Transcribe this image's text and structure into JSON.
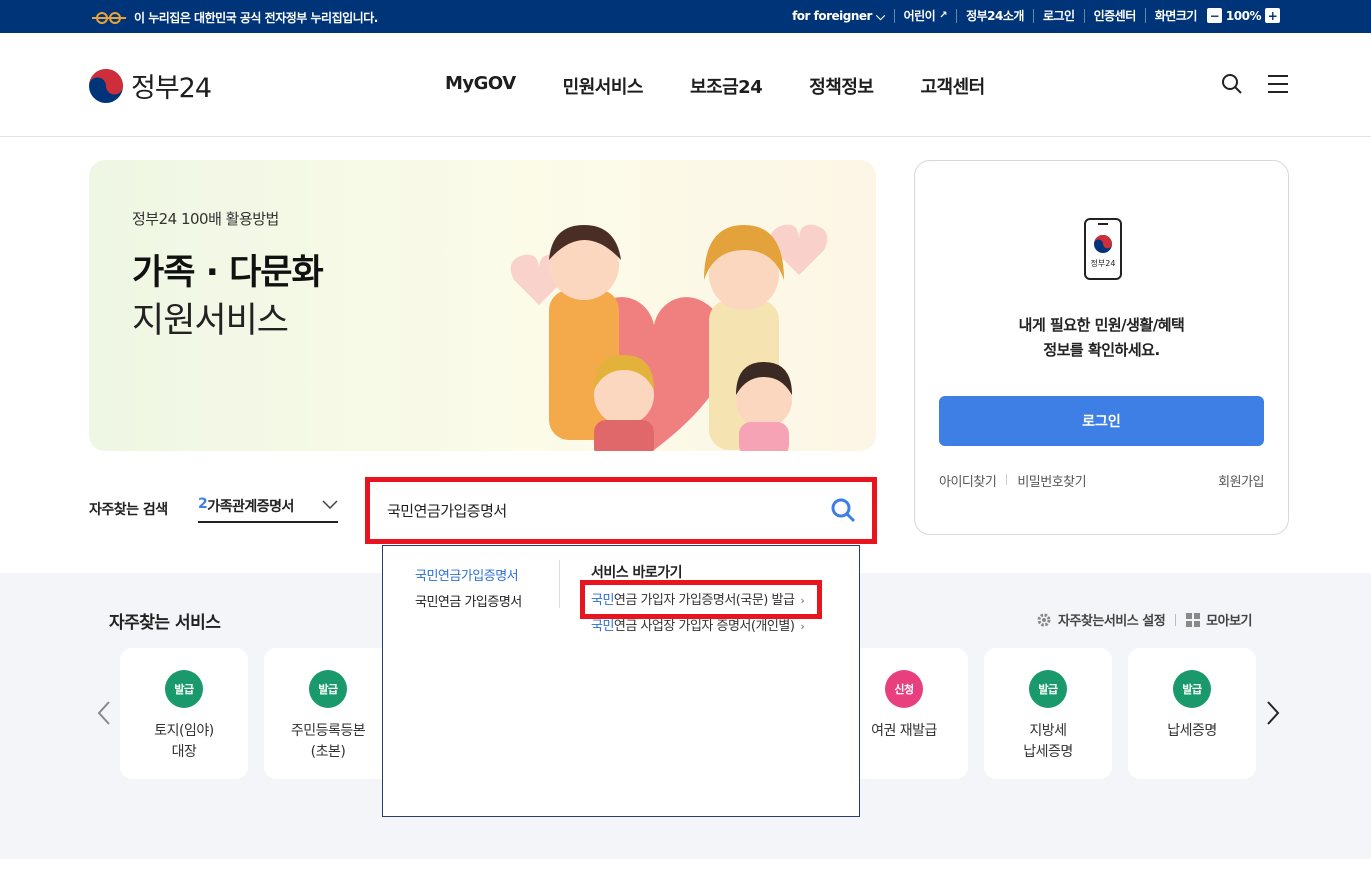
{
  "topbar": {
    "gov_notice": "이 누리집은 대한민국 공식 전자정부 누리집입니다.",
    "links": [
      "for foreigner",
      "어린이",
      "정부24소개",
      "로그인",
      "인증센터"
    ],
    "zoom_label": "화면크기",
    "zoom_value": "100%",
    "zoom_minus": "−",
    "zoom_plus": "+"
  },
  "header": {
    "logo_text": "정부24",
    "nav": [
      "MyGOV",
      "민원서비스",
      "보조금24",
      "정책정보",
      "고객센터"
    ]
  },
  "banner": {
    "subtitle": "정부24 100배 활용방법",
    "title_line1": "가족 · 다문화",
    "title_line2": "지원서비스"
  },
  "login": {
    "phone_label": "정부24",
    "message_line1": "내게 필요한 민원/생활/혜택",
    "message_line2": "정보를 확인하세요.",
    "button": "로그인",
    "find_id": "아이디찾기",
    "find_pw": "비밀번호찾기",
    "signup": "회원가입"
  },
  "search": {
    "fav_label": "자주찾는 검색",
    "fav_num": "2",
    "fav_value": "가족관계증명서",
    "query": "국민연금가입증명서"
  },
  "autocomplete": {
    "suggestions": [
      {
        "hit": "국민연금가입증명서",
        "rest": ""
      },
      {
        "hit": "",
        "rest": "국민연금 가입증명서"
      }
    ],
    "shortcut_header": "서비스 바로가기",
    "shortcuts": [
      {
        "hit": "국민",
        "rest": "연금 가입자 가입증명서(국문) 발급"
      },
      {
        "hit": "국민",
        "rest": "연금 사업장 가입자 증명서(개인별)"
      }
    ],
    "chevron": "›"
  },
  "favorites": {
    "title": "자주찾는 서비스",
    "settings": "자주찾는서비스 설정",
    "view_all": "모아보기",
    "cards": [
      {
        "badge": "발급",
        "badge_color": "#1a9a6c",
        "name": "토지(임야)\n대장"
      },
      {
        "badge": "발급",
        "badge_color": "#1a9a6c",
        "name": "주민등록등본\n(초본)"
      },
      {
        "badge": "신청",
        "badge_color": "#e8407e",
        "name": "여권 재발급"
      },
      {
        "badge": "발급",
        "badge_color": "#1a9a6c",
        "name": "지방세\n납세증명"
      },
      {
        "badge": "발급",
        "badge_color": "#1a9a6c",
        "name": "납세증명"
      }
    ]
  },
  "colors": {
    "topbar_bg": "#003478",
    "accent_blue": "#3d7fe4",
    "highlight_red": "#e8151f"
  }
}
